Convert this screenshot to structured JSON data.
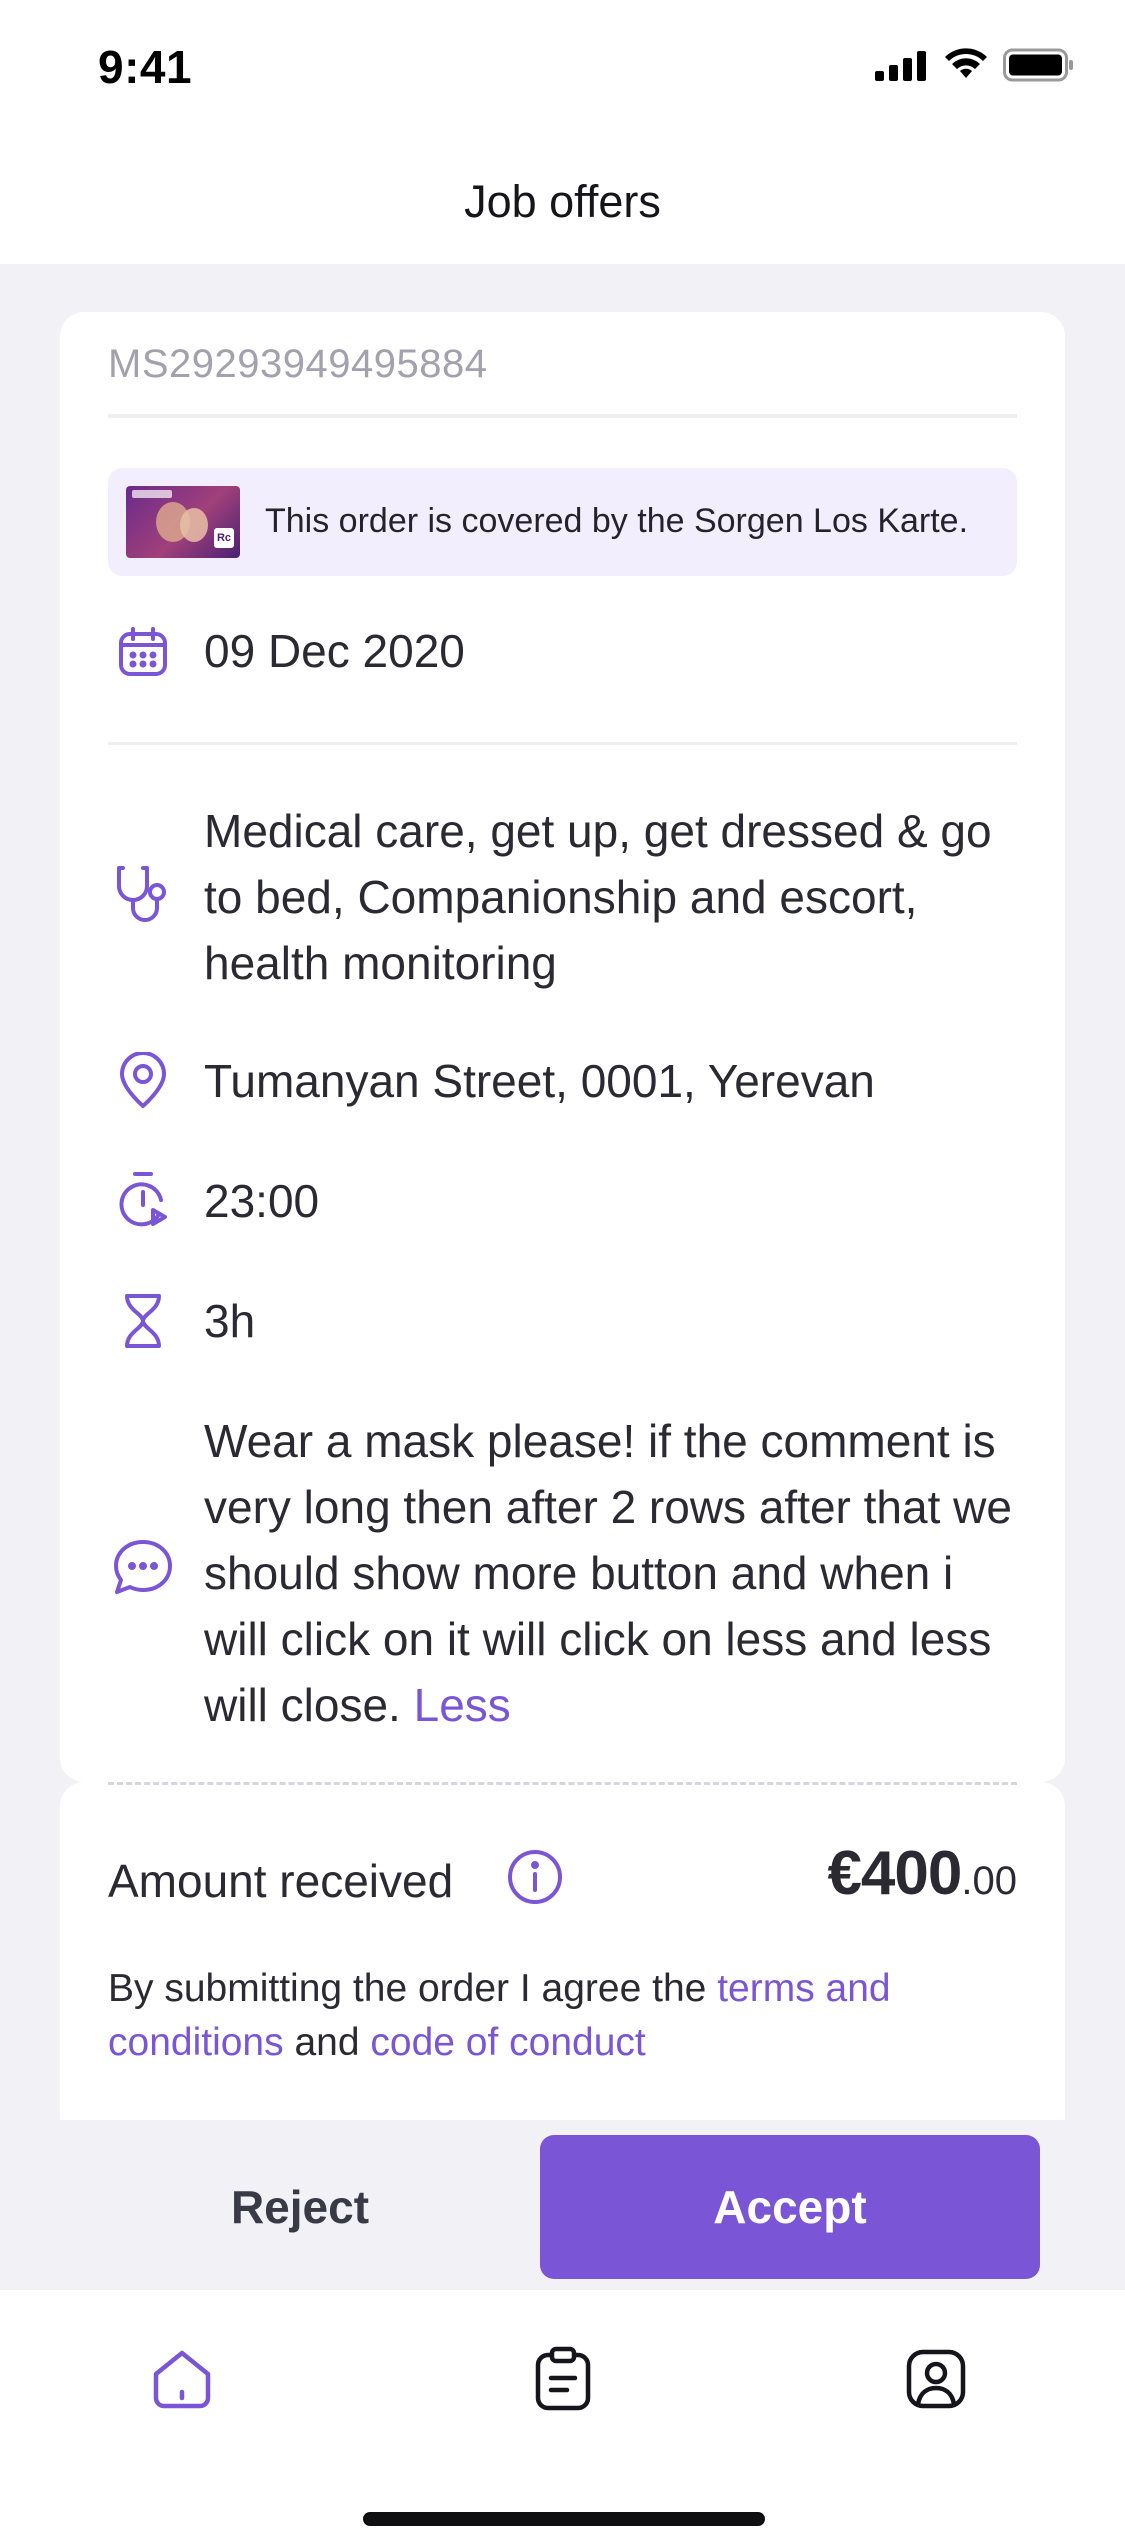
{
  "status_bar": {
    "time": "9:41",
    "icons": [
      "signal-icon",
      "wifi-icon",
      "battery-icon"
    ]
  },
  "header": {
    "title": "Job offers"
  },
  "order": {
    "id": "MS29293949495884",
    "banner_text": "This order is covered by the Sorgen Los Karte.",
    "date": "09 Dec 2020",
    "services": "Medical care, get up, get dressed & go to bed, Companionship and escort, health monitoring",
    "address": "Tumanyan Street, 0001, Yerevan",
    "time": "23:00",
    "duration": "3h",
    "comment": "Wear a mask please! if the comment is very long then after 2 rows after that we should show more button and when i will click on it will click on less and less will close.",
    "comment_toggle": "Less"
  },
  "payment": {
    "label": "Amount received",
    "amount_main": "€400",
    "amount_cents": ".00",
    "agree_prefix": "By submitting the order I agree the",
    "terms_link": "terms and conditions",
    "agree_and": "and",
    "conduct_link": "code of conduct"
  },
  "actions": {
    "reject_label": "Reject",
    "accept_label": "Accept"
  },
  "tab_bar": {
    "items": [
      "home-icon",
      "orders-icon",
      "profile-icon"
    ],
    "active": "home-icon"
  },
  "colors": {
    "accent": "#7A55D6",
    "banner_bg": "#F3EEFD",
    "page_bg": "#F2F1F6"
  }
}
